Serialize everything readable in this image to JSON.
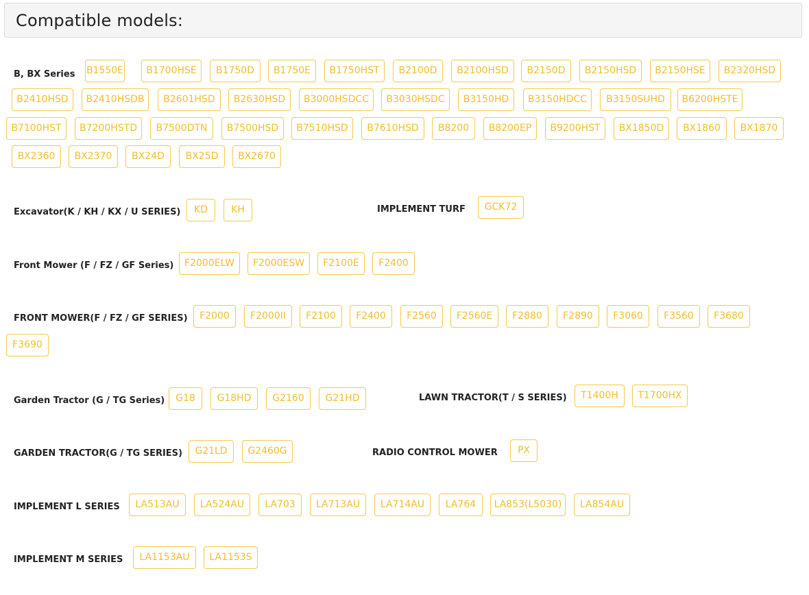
{
  "header": {
    "title": "Compatible models:"
  },
  "groups": [
    {
      "label": "B, BX Series",
      "models": [
        "B1550E",
        "B1700HSE",
        "B1750D",
        "B1750E",
        "B1750HST",
        "B2100D",
        "B2100HSD",
        "B2150D",
        "B2150HSD",
        "B2150HSE",
        "B2320HSD",
        "B2410HSD",
        "B2410HSDB",
        "B2601HSD",
        "B2630HSD",
        "B3000HSDCC",
        "B3030HSDC",
        "B3150HD",
        "B3150HDCC",
        "B3150SUHD",
        "B6200HSTE",
        "B7100HST",
        "B7200HSTD",
        "B7500DTN",
        "B7500HSD",
        "B7510HSD",
        "B7610HSD",
        "B8200",
        "B8200EP",
        "B9200HST",
        "BX1850D",
        "BX1860",
        "BX1870",
        "BX2360",
        "BX2370",
        "BX24D",
        "BX25D",
        "BX2670"
      ]
    },
    {
      "label": "Excavator(K / KH / KX / U SERIES)",
      "models": [
        "KD",
        "KH"
      ]
    },
    {
      "label": "IMPLEMENT TURF",
      "models": [
        "GCK72"
      ]
    },
    {
      "label": "Front Mower (F / FZ / GF Series)",
      "models": [
        "F2000ELW",
        "F2000ESW",
        "F2100E",
        "F2400"
      ]
    },
    {
      "label": "FRONT MOWER(F / FZ / GF SERIES)",
      "models": [
        "F2000",
        "F2000II",
        "F2100",
        "F2400",
        "F2560",
        "F2560E",
        "F2880",
        "F2890",
        "F3060",
        "F3560",
        "F3680",
        "F3690"
      ]
    },
    {
      "label": "Garden Tractor (G / TG Series)",
      "models": [
        "G18",
        "G18HD",
        "G2160",
        "G21HD"
      ]
    },
    {
      "label": "LAWN TRACTOR(T / S SERIES)",
      "models": [
        "T1400H",
        "T1700HX"
      ]
    },
    {
      "label": "GARDEN TRACTOR(G / TG SERIES)",
      "models": [
        "G21LD",
        "G2460G"
      ]
    },
    {
      "label": "RADIO CONTROL MOWER",
      "models": [
        "PX"
      ]
    },
    {
      "label": "IMPLEMENT L SERIES",
      "models": [
        "LA513AU",
        "LA524AU",
        "LA703",
        "LA713AU",
        "LA714AU",
        "LA764",
        "LA853(L5030)",
        "LA854AU"
      ]
    },
    {
      "label": "IMPLEMENT M SERIES",
      "models": [
        "LA1153AU",
        "LA1153S"
      ]
    }
  ],
  "colors": {
    "tag_border": "#f4c945",
    "tag_text": "#f0be2e",
    "header_bg": "#f5f5f5"
  }
}
